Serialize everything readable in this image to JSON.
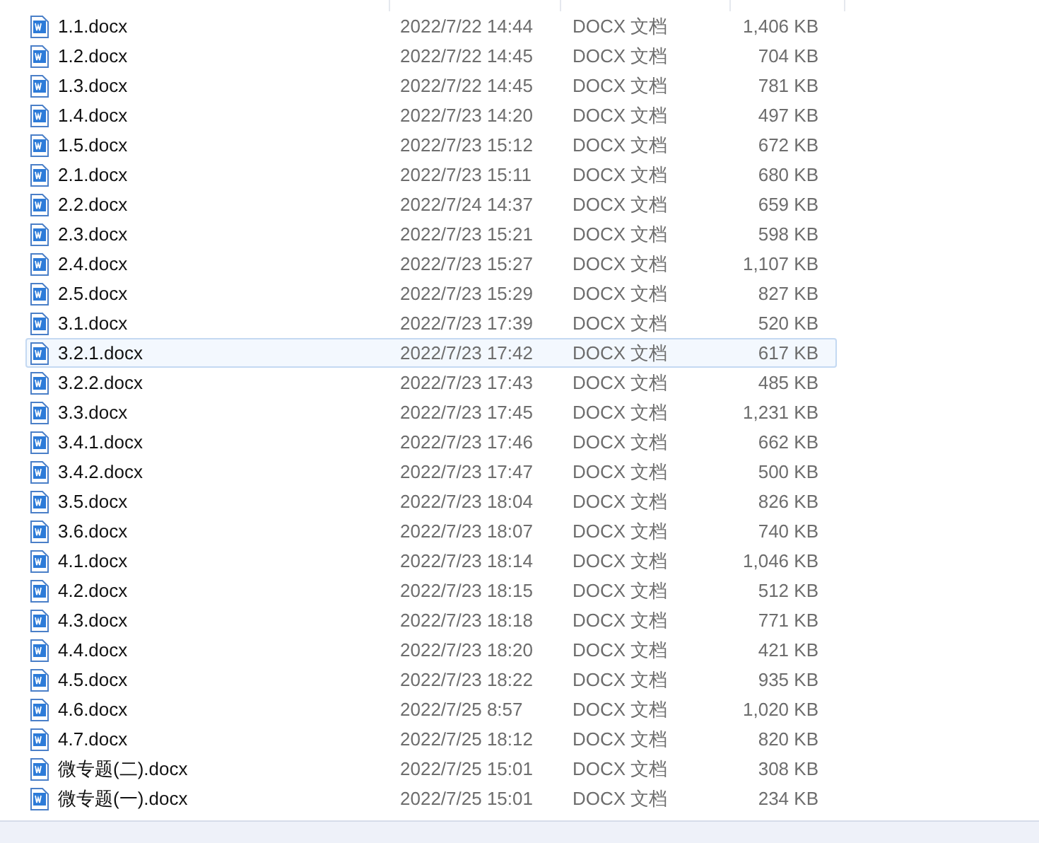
{
  "files": [
    {
      "name": "1.1.docx",
      "modified": "2022/7/22 14:44",
      "type": "DOCX 文档",
      "size": "1,406 KB",
      "selected": false
    },
    {
      "name": "1.2.docx",
      "modified": "2022/7/22 14:45",
      "type": "DOCX 文档",
      "size": "704 KB",
      "selected": false
    },
    {
      "name": "1.3.docx",
      "modified": "2022/7/22 14:45",
      "type": "DOCX 文档",
      "size": "781 KB",
      "selected": false
    },
    {
      "name": "1.4.docx",
      "modified": "2022/7/23 14:20",
      "type": "DOCX 文档",
      "size": "497 KB",
      "selected": false
    },
    {
      "name": "1.5.docx",
      "modified": "2022/7/23 15:12",
      "type": "DOCX 文档",
      "size": "672 KB",
      "selected": false
    },
    {
      "name": "2.1.docx",
      "modified": "2022/7/23 15:11",
      "type": "DOCX 文档",
      "size": "680 KB",
      "selected": false
    },
    {
      "name": "2.2.docx",
      "modified": "2022/7/24 14:37",
      "type": "DOCX 文档",
      "size": "659 KB",
      "selected": false
    },
    {
      "name": "2.3.docx",
      "modified": "2022/7/23 15:21",
      "type": "DOCX 文档",
      "size": "598 KB",
      "selected": false
    },
    {
      "name": "2.4.docx",
      "modified": "2022/7/23 15:27",
      "type": "DOCX 文档",
      "size": "1,107 KB",
      "selected": false
    },
    {
      "name": "2.5.docx",
      "modified": "2022/7/23 15:29",
      "type": "DOCX 文档",
      "size": "827 KB",
      "selected": false
    },
    {
      "name": "3.1.docx",
      "modified": "2022/7/23 17:39",
      "type": "DOCX 文档",
      "size": "520 KB",
      "selected": false
    },
    {
      "name": "3.2.1.docx",
      "modified": "2022/7/23 17:42",
      "type": "DOCX 文档",
      "size": "617 KB",
      "selected": true
    },
    {
      "name": "3.2.2.docx",
      "modified": "2022/7/23 17:43",
      "type": "DOCX 文档",
      "size": "485 KB",
      "selected": false
    },
    {
      "name": "3.3.docx",
      "modified": "2022/7/23 17:45",
      "type": "DOCX 文档",
      "size": "1,231 KB",
      "selected": false
    },
    {
      "name": "3.4.1.docx",
      "modified": "2022/7/23 17:46",
      "type": "DOCX 文档",
      "size": "662 KB",
      "selected": false
    },
    {
      "name": "3.4.2.docx",
      "modified": "2022/7/23 17:47",
      "type": "DOCX 文档",
      "size": "500 KB",
      "selected": false
    },
    {
      "name": "3.5.docx",
      "modified": "2022/7/23 18:04",
      "type": "DOCX 文档",
      "size": "826 KB",
      "selected": false
    },
    {
      "name": "3.6.docx",
      "modified": "2022/7/23 18:07",
      "type": "DOCX 文档",
      "size": "740 KB",
      "selected": false
    },
    {
      "name": "4.1.docx",
      "modified": "2022/7/23 18:14",
      "type": "DOCX 文档",
      "size": "1,046 KB",
      "selected": false
    },
    {
      "name": "4.2.docx",
      "modified": "2022/7/23 18:15",
      "type": "DOCX 文档",
      "size": "512 KB",
      "selected": false
    },
    {
      "name": "4.3.docx",
      "modified": "2022/7/23 18:18",
      "type": "DOCX 文档",
      "size": "771 KB",
      "selected": false
    },
    {
      "name": "4.4.docx",
      "modified": "2022/7/23 18:20",
      "type": "DOCX 文档",
      "size": "421 KB",
      "selected": false
    },
    {
      "name": "4.5.docx",
      "modified": "2022/7/23 18:22",
      "type": "DOCX 文档",
      "size": "935 KB",
      "selected": false
    },
    {
      "name": "4.6.docx",
      "modified": "2022/7/25 8:57",
      "type": "DOCX 文档",
      "size": "1,020 KB",
      "selected": false
    },
    {
      "name": "4.7.docx",
      "modified": "2022/7/25 18:12",
      "type": "DOCX 文档",
      "size": "820 KB",
      "selected": false
    },
    {
      "name": "微专题(二).docx",
      "modified": "2022/7/25 15:01",
      "type": "DOCX 文档",
      "size": "308 KB",
      "selected": false
    },
    {
      "name": "微专题(一).docx",
      "modified": "2022/7/25 15:01",
      "type": "DOCX 文档",
      "size": "234 KB",
      "selected": false
    }
  ]
}
